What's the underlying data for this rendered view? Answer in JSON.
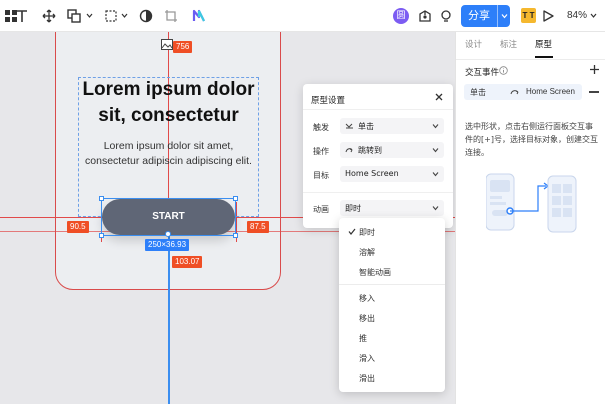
{
  "toolbar": {
    "icons": [
      "menu-grid-icon",
      "text-icon",
      "move-icon",
      "shape-icon",
      "frame-icon",
      "ellipse-icon",
      "crop-icon",
      "plugin-logo-icon",
      "avatar",
      "component-icon",
      "lightbulb-icon",
      "share-caret-icon",
      "ai-badge",
      "play-icon"
    ],
    "avatar_text": "圆",
    "share_label": "分享",
    "tt_badge": "T T",
    "zoom": "84%"
  },
  "canvas": {
    "heading": "Lorem ipsum dolor sit, consectetur",
    "body": "Lorem ipsum dolor sit amet, consectetur  adipiscin adipiscing elit.",
    "button_label": "START",
    "measure_top": "756",
    "measure_left": "90.5",
    "measure_right": "87.5",
    "measure_bottom": "103.07",
    "size_label": "250×36.93"
  },
  "prototype_panel": {
    "title": "原型设置",
    "rows": [
      {
        "label": "触发",
        "value": "单击"
      },
      {
        "label": "操作",
        "value": "跳转到"
      },
      {
        "label": "目标",
        "value": "Home Screen"
      },
      {
        "label": "动画",
        "value": "即时"
      }
    ]
  },
  "animation_menu": {
    "items": [
      "即时",
      "溶解",
      "智能动画",
      "移入",
      "移出",
      "推",
      "滑入",
      "滑出"
    ],
    "selected": "即时"
  },
  "right_panel": {
    "tabs": [
      "设计",
      "标注",
      "原型"
    ],
    "active_tab": "原型",
    "section_title": "交互事件",
    "interaction": {
      "trigger": "单击",
      "target": "Home Screen"
    },
    "help_text": "选中形状，点击右侧运行面板交互事件的[+]号，选择目标对象，创建交互连接。"
  },
  "colors": {
    "accent": "#2d7ff9",
    "guide_red": "#e14a4a",
    "tag_red": "#ef4e25",
    "button": "#5f6676"
  }
}
